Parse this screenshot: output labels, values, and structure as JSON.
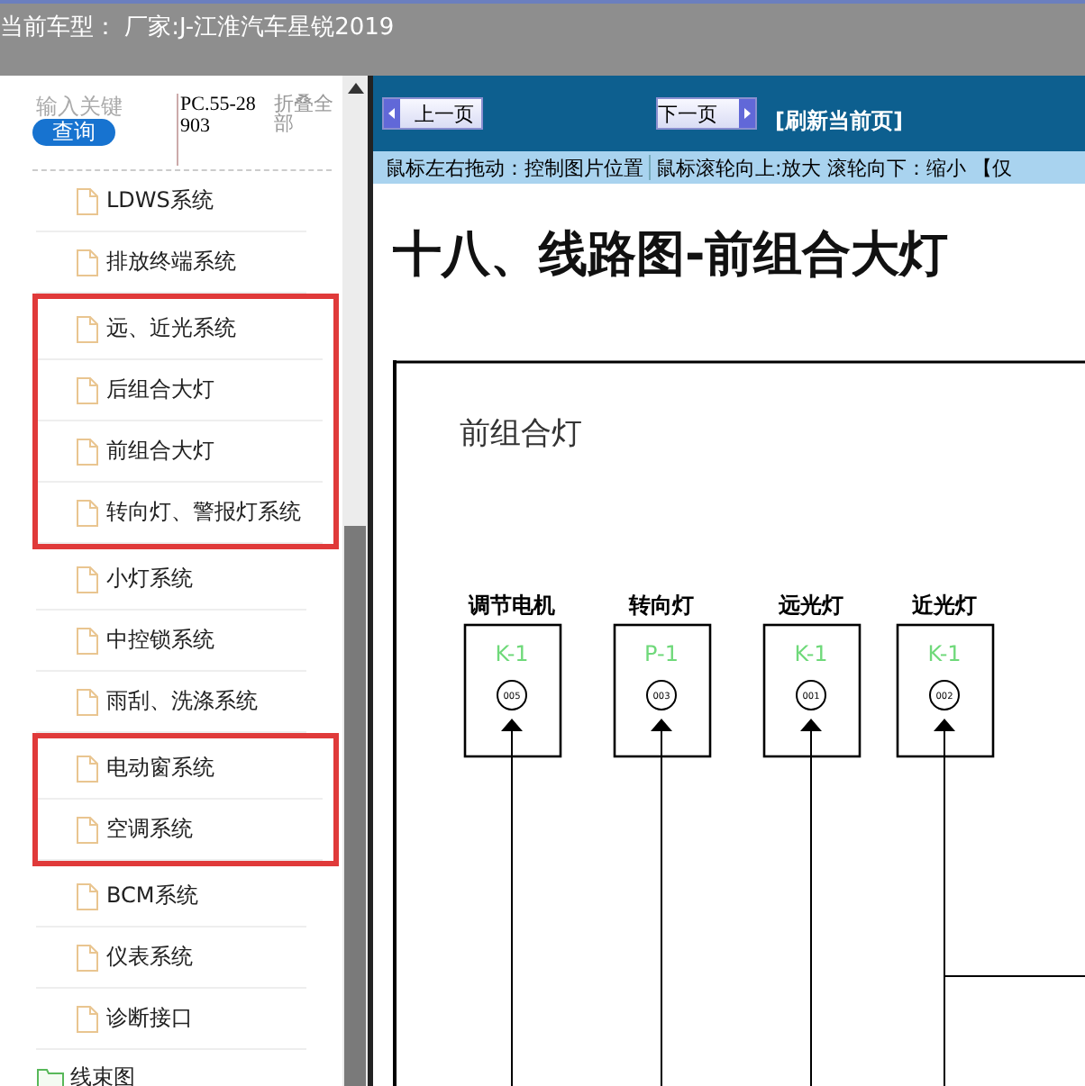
{
  "header": {
    "title": "当前车型： 厂家:J-江淮汽车星锐2019"
  },
  "sidebar": {
    "search": {
      "placeholder": "输入关键"
    },
    "query_button": "查询",
    "part_number": "PC.55-28903",
    "collapse_all": "折叠全部",
    "groups": [
      {
        "boxed": false,
        "items": [
          {
            "label": "LDWS系统"
          },
          {
            "label": "排放终端系统"
          }
        ]
      },
      {
        "boxed": true,
        "items": [
          {
            "label": "远、近光系统"
          },
          {
            "label": "后组合大灯"
          },
          {
            "label": "前组合大灯"
          },
          {
            "label": "转向灯、警报灯系统"
          }
        ]
      },
      {
        "boxed": false,
        "items": [
          {
            "label": "小灯系统"
          },
          {
            "label": "中控锁系统"
          },
          {
            "label": "雨刮、洗涤系统"
          }
        ]
      },
      {
        "boxed": true,
        "items": [
          {
            "label": "电动窗系统"
          },
          {
            "label": "空调系统"
          }
        ]
      },
      {
        "boxed": false,
        "items": [
          {
            "label": "BCM系统"
          },
          {
            "label": "仪表系统"
          },
          {
            "label": "诊断接口"
          }
        ]
      }
    ],
    "folder": {
      "label": "线束图"
    }
  },
  "toolbar": {
    "prev_button": "上一页",
    "next_button": "下一页",
    "refresh_link": "[刷新当前页]"
  },
  "hint": {
    "drag": "鼠标左右拖动：控制图片位置",
    "zoom": "鼠标滚轮向上:放大  滚轮向下：缩小 【仅"
  },
  "page": {
    "title": "十八、线路图-前组合大灯",
    "diagram": {
      "title": "前组合灯",
      "connectors": [
        {
          "label": "调节电机",
          "code": "K-1",
          "pin": "005"
        },
        {
          "label": "转向灯",
          "code": "P-1",
          "pin": "003"
        },
        {
          "label": "远光灯",
          "code": "K-1",
          "pin": "001"
        },
        {
          "label": "近光灯",
          "code": "K-1",
          "pin": "002"
        }
      ]
    }
  }
}
